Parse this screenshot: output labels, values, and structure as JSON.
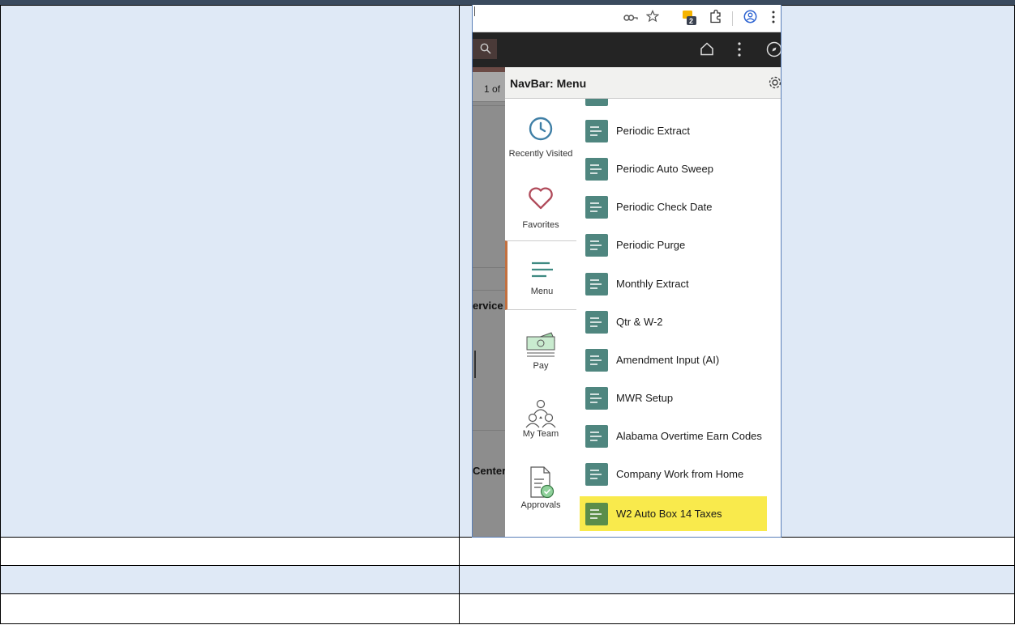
{
  "document": {
    "background_accent": "#dfe9f6"
  },
  "screenshot": {
    "tab_count_badge": "2",
    "behind_page": {
      "pager_text": "1 of",
      "label_service": "ervice",
      "label_center": "Center"
    },
    "navbar": {
      "title": "NavBar: Menu",
      "sidebar": [
        {
          "label": "Recently Visited",
          "icon": "clock-icon"
        },
        {
          "label": "Favorites",
          "icon": "heart-icon"
        },
        {
          "label": "Menu",
          "icon": "menu-lines-icon",
          "selected": true
        },
        {
          "label": "Pay",
          "icon": "money-icon"
        },
        {
          "label": "My Team",
          "icon": "team-icon"
        },
        {
          "label": "Approvals",
          "icon": "approvals-icon"
        }
      ],
      "menu_items": [
        {
          "label": "Periodic Extract"
        },
        {
          "label": "Periodic Auto Sweep"
        },
        {
          "label": "Periodic Check Date"
        },
        {
          "label": "Periodic Purge"
        },
        {
          "label": "Monthly Extract"
        },
        {
          "label": "Qtr & W-2"
        },
        {
          "label": "Amendment Input (AI)"
        },
        {
          "label": "MWR Setup"
        },
        {
          "label": "Alabama Overtime Earn Codes"
        },
        {
          "label": "Company Work from Home"
        },
        {
          "label": "W2 Auto Box 14 Taxes",
          "highlighted": true
        }
      ]
    }
  }
}
